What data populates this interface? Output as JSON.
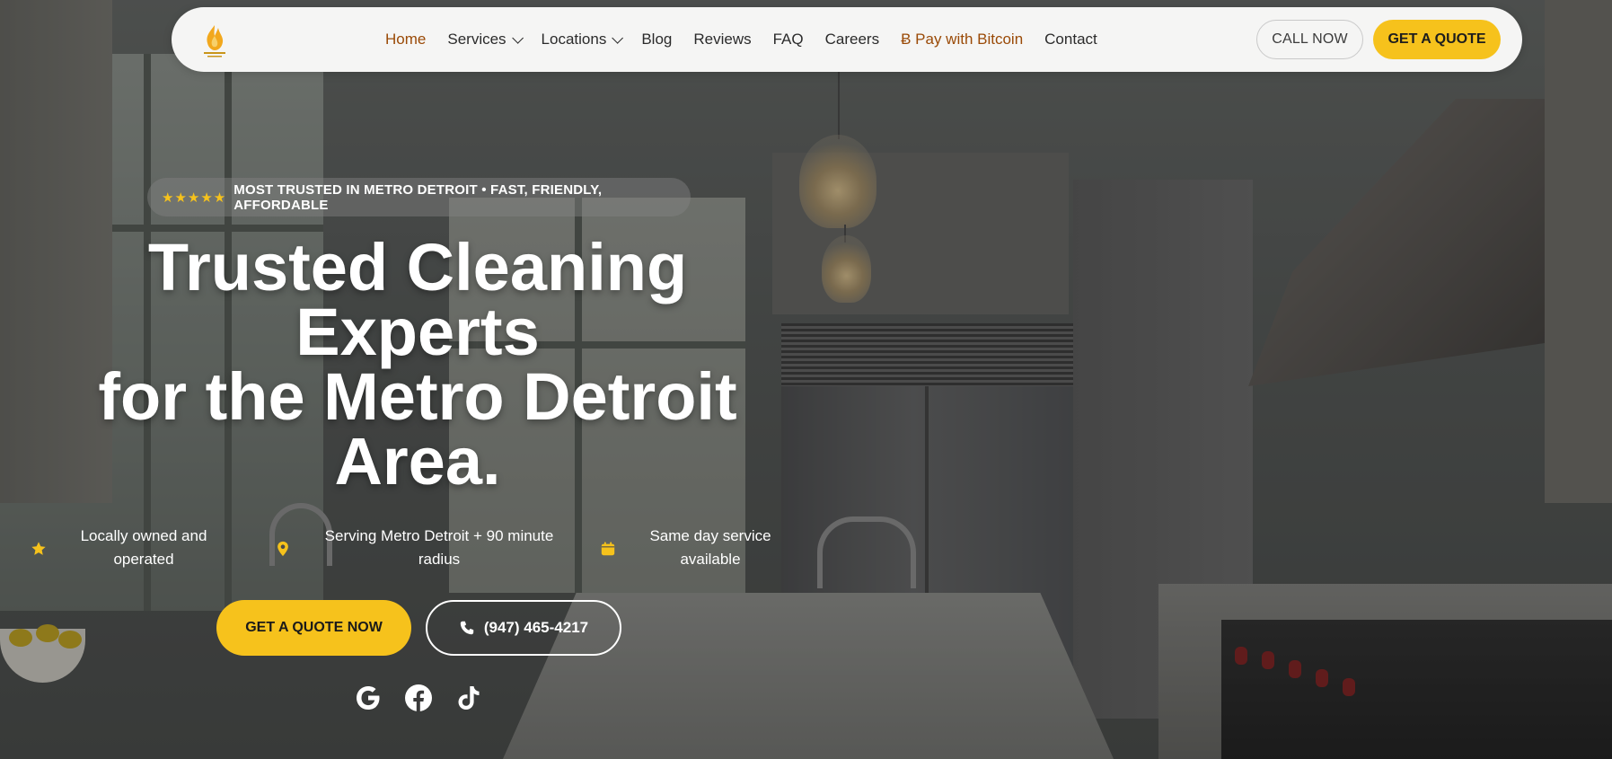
{
  "colors": {
    "accent": "#f6c21c",
    "nav_active": "#9a4a07",
    "nav_text": "#2b2b2b",
    "nav_bg": "#f5f5f4",
    "white": "#ffffff"
  },
  "header": {
    "logo_icon": "flame-logo-icon",
    "nav": [
      {
        "label": "Home",
        "active": true
      },
      {
        "label": "Services",
        "dropdown": true
      },
      {
        "label": "Locations",
        "dropdown": true
      },
      {
        "label": "Blog"
      },
      {
        "label": "Reviews"
      },
      {
        "label": "FAQ"
      },
      {
        "label": "Careers"
      },
      {
        "label": "Ƀ Pay with Bitcoin"
      },
      {
        "label": "Contact"
      }
    ],
    "call_label": "CALL NOW",
    "quote_label": "GET A QUOTE"
  },
  "hero": {
    "badge_stars": "★★★★★",
    "badge_text": "MOST TRUSTED IN METRO DETROIT • FAST, FRIENDLY, AFFORDABLE",
    "title_lines": [
      "Trusted Cleaning",
      "Experts",
      "for the Metro Detroit",
      "Area."
    ],
    "features": [
      {
        "icon": "star-icon",
        "line1": "Locally owned and",
        "line2": "operated"
      },
      {
        "icon": "map-pin-icon",
        "line1": "Serving Metro Detroit + 90 minute",
        "line2": "radius"
      },
      {
        "icon": "calendar-icon",
        "line1": "Same day service",
        "line2": "available"
      }
    ],
    "cta_quote": "GET A QUOTE NOW",
    "cta_phone": "(947) 465-4217",
    "socials": [
      "google-icon",
      "facebook-icon",
      "tiktok-icon"
    ]
  }
}
